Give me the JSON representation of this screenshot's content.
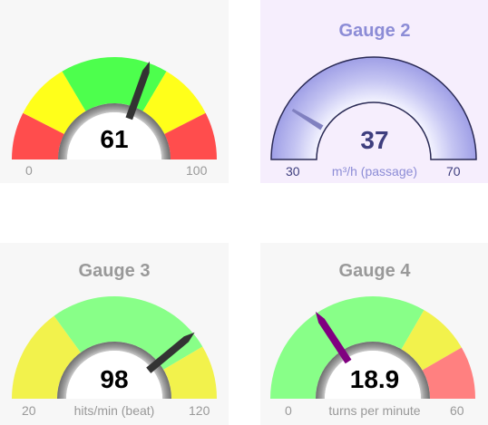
{
  "gauges": [
    {
      "title": "",
      "value": "61",
      "value_num": 61,
      "min": "0",
      "max": "100",
      "min_num": 0,
      "max_num": 100,
      "unit": "",
      "panel_bg": "#f7f7f7",
      "value_color": "#000000",
      "label_color": "#999999",
      "needle_color": "#333333",
      "needle_icon": "pointer-needle-icon",
      "bands": [
        {
          "from": 0,
          "to": 15,
          "color": "#ff4d4d"
        },
        {
          "from": 15,
          "to": 33,
          "color": "#ffff1a"
        },
        {
          "from": 33,
          "to": 67,
          "color": "#4dff4d"
        },
        {
          "from": 67,
          "to": 85,
          "color": "#ffff1a"
        },
        {
          "from": 85,
          "to": 100,
          "color": "#ff4d4d"
        }
      ]
    },
    {
      "title": "Gauge 2",
      "value": "37",
      "value_num": 37,
      "min": "30",
      "max": "70",
      "min_num": 30,
      "max_num": 70,
      "unit": "m³/h (passage)",
      "panel_bg": "#f6eefd",
      "value_color": "#3e3e7e",
      "label_color": "#3e3e7e",
      "title_color": "#8c8cd6",
      "unit_color": "#8c8cd6",
      "needle_color": "#8080c0",
      "needle_icon": "blade-needle-icon"
    },
    {
      "title": "Gauge 3",
      "value": "98",
      "value_num": 98,
      "min": "20",
      "max": "120",
      "min_num": 20,
      "max_num": 120,
      "unit": "hits/min (beat)",
      "panel_bg": "#f7f7f7",
      "value_color": "#000000",
      "label_color": "#999999",
      "needle_color": "#333333",
      "needle_icon": "pointer-needle-icon",
      "bands": [
        {
          "from": 20,
          "to": 50,
          "color": "#f2f24c"
        },
        {
          "from": 50,
          "to": 103,
          "color": "#88ff88"
        },
        {
          "from": 103,
          "to": 120,
          "color": "#f2f24c"
        }
      ]
    },
    {
      "title": "Gauge 4",
      "value": "18.9",
      "value_num": 18.9,
      "min": "0",
      "max": "60",
      "min_num": 0,
      "max_num": 60,
      "unit": "turns per minute",
      "panel_bg": "#f7f7f7",
      "value_color": "#000000",
      "label_color": "#999999",
      "needle_color": "#800080",
      "needle_icon": "pointer-needle-icon",
      "bands": [
        {
          "from": 0,
          "to": 40,
          "color": "#88ff88"
        },
        {
          "from": 40,
          "to": 50,
          "color": "#f2f24c"
        },
        {
          "from": 50,
          "to": 60,
          "color": "#ff8080"
        }
      ]
    }
  ]
}
